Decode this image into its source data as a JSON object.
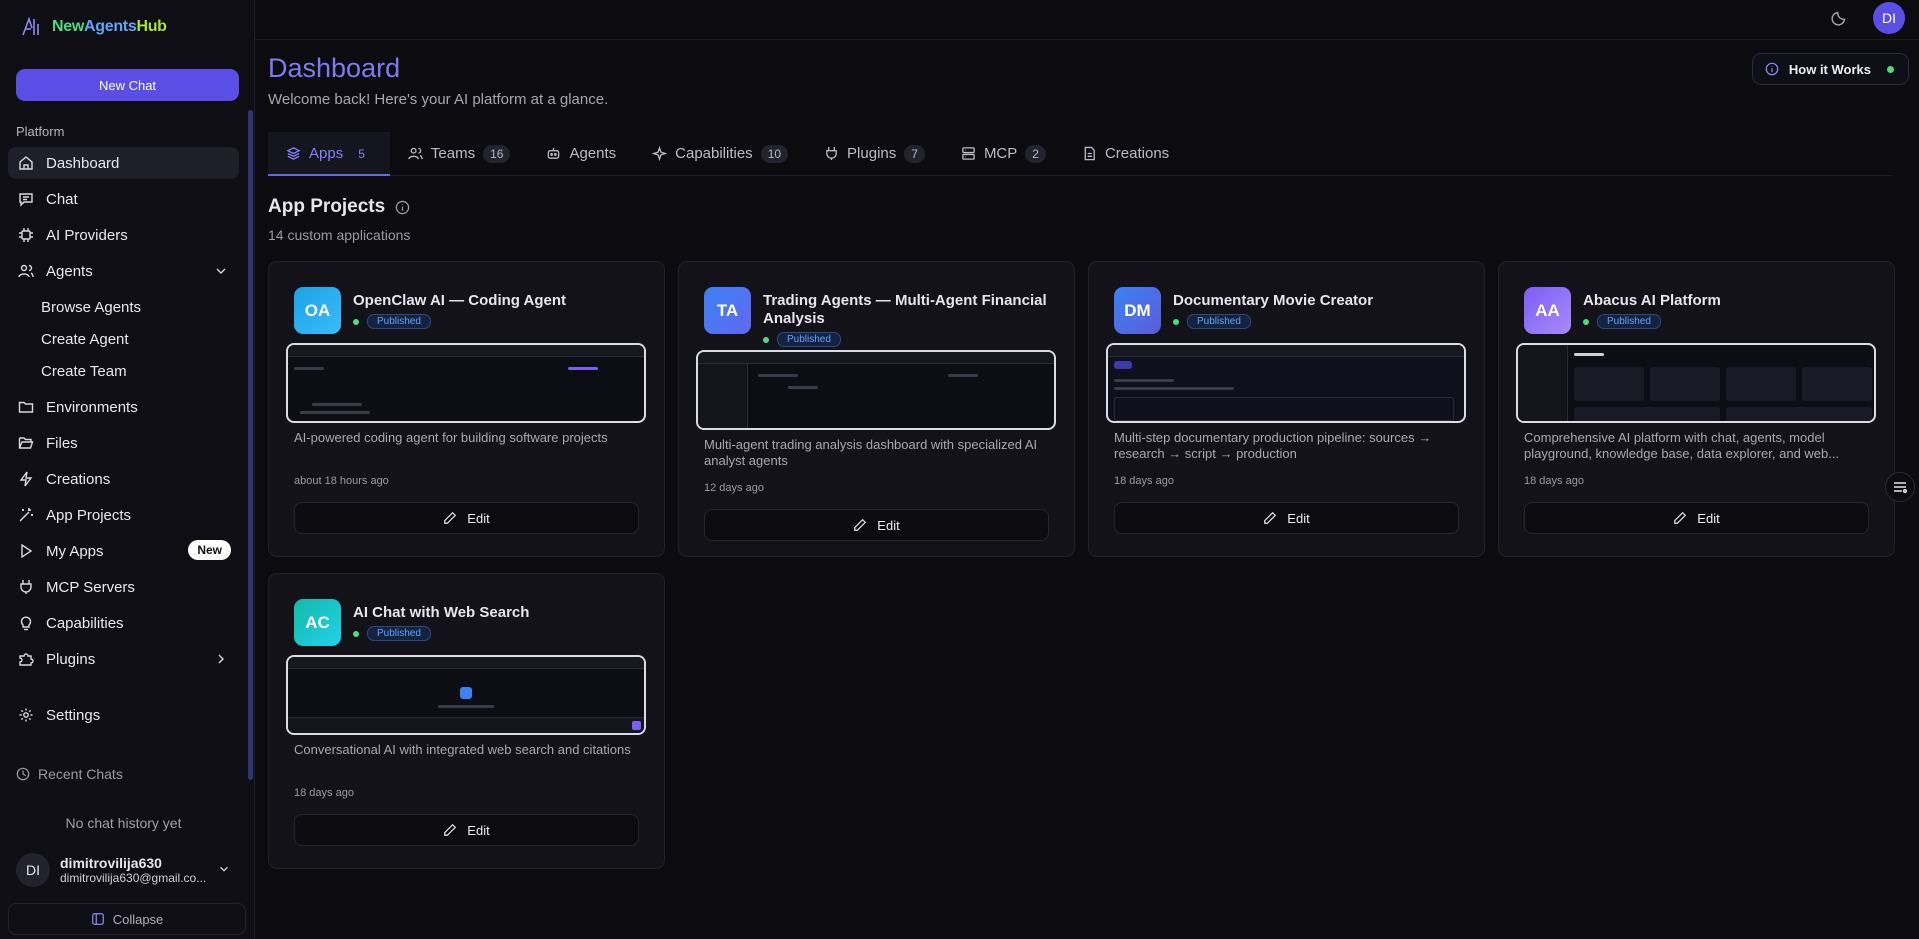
{
  "brand": {
    "part1": "New",
    "part2": "Agents",
    "part3": "Hub"
  },
  "sidebar": {
    "new_chat": "New Chat",
    "section": "Platform",
    "items": [
      {
        "label": "Dashboard",
        "icon": "home-icon"
      },
      {
        "label": "Chat",
        "icon": "chat-icon"
      },
      {
        "label": "AI Providers",
        "icon": "chip-icon"
      },
      {
        "label": "Agents",
        "icon": "users-icon"
      },
      {
        "label": "Environments",
        "icon": "folder-icon"
      },
      {
        "label": "Files",
        "icon": "folder-open-icon"
      },
      {
        "label": "Creations",
        "icon": "bolt-icon"
      },
      {
        "label": "App Projects",
        "icon": "wand-icon"
      },
      {
        "label": "My Apps",
        "icon": "play-icon",
        "badge": "New"
      },
      {
        "label": "MCP Servers",
        "icon": "plug-icon"
      },
      {
        "label": "Capabilities",
        "icon": "bulb-icon"
      },
      {
        "label": "Plugins",
        "icon": "puzzle-icon"
      },
      {
        "label": "Settings",
        "icon": "gear-icon"
      }
    ],
    "agents_sub": [
      "Browse Agents",
      "Create Agent",
      "Create Team"
    ],
    "recent_chats": "Recent Chats",
    "no_history": "No chat history yet",
    "user": {
      "initials": "DI",
      "name": "dimitrovilija630",
      "email": "dimitrovilija630@gmail.co..."
    },
    "collapse": "Collapse"
  },
  "topbar": {
    "avatar": "DI"
  },
  "header": {
    "title": "Dashboard",
    "subtitle": "Welcome back! Here's your AI platform at a glance.",
    "how": "How it Works"
  },
  "tabs": [
    {
      "label": "Apps",
      "count": "5"
    },
    {
      "label": "Teams",
      "count": "16"
    },
    {
      "label": "Agents",
      "count": ""
    },
    {
      "label": "Capabilities",
      "count": "10"
    },
    {
      "label": "Plugins",
      "count": "7"
    },
    {
      "label": "MCP",
      "count": "2"
    },
    {
      "label": "Creations",
      "count": ""
    }
  ],
  "section": {
    "title": "App Projects",
    "subtitle": "14 custom applications"
  },
  "cards": [
    {
      "initials": "OA",
      "title": "OpenClaw AI — Coding Agent",
      "status": "Published",
      "desc": "AI-powered coding agent for building software projects",
      "time": "about 18 hours ago",
      "edit": "Edit",
      "color": "#1da1e6"
    },
    {
      "initials": "TA",
      "title": "Trading Agents — Multi-Agent Financial Analysis",
      "status": "Published",
      "desc": "Multi-agent trading analysis dashboard with specialized AI analyst agents",
      "time": "12 days ago",
      "edit": "Edit",
      "color": "#4f7cf5"
    },
    {
      "initials": "DM",
      "title": "Documentary Movie Creator",
      "status": "Published",
      "desc": "Multi-step documentary production pipeline: sources → research → script → production",
      "time": "18 days ago",
      "edit": "Edit",
      "color": "#4f6ee8"
    },
    {
      "initials": "AA",
      "title": "Abacus AI Platform",
      "status": "Published",
      "desc": "Comprehensive AI platform with chat, agents, model playground, knowledge base, data explorer, and web...",
      "time": "18 days ago",
      "edit": "Edit",
      "color": "#7c5cf5"
    },
    {
      "initials": "AC",
      "title": "AI Chat with Web Search",
      "status": "Published",
      "desc": "Conversational AI with integrated web search and citations",
      "time": "18 days ago",
      "edit": "Edit",
      "color": "#14b8a6"
    }
  ]
}
